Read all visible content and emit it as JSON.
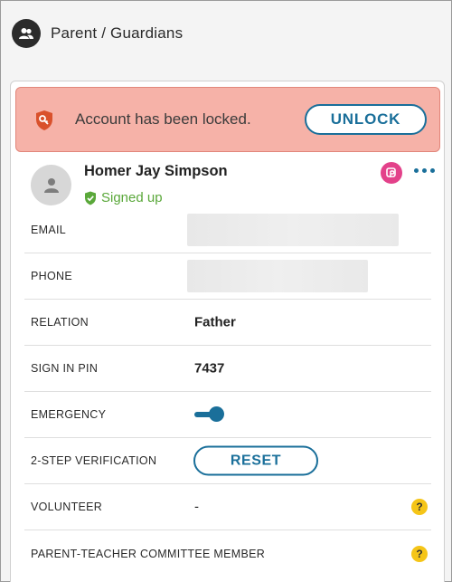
{
  "header": {
    "title": "Parent / Guardians",
    "icon": "people-icon"
  },
  "banner": {
    "message": "Account has been locked.",
    "unlock_label": "UNLOCK",
    "icon": "locked-shield-icon",
    "bg_color": "#f6b2a8"
  },
  "contact": {
    "name": "Homer Jay Simpson",
    "status": "Signed up",
    "status_color": "#5aa83a",
    "avatar_icon": "person-icon",
    "app_icon": "parent-app-icon",
    "menu_icon": "more-horizontal-icon"
  },
  "fields": {
    "email": {
      "label": "EMAIL"
    },
    "phone": {
      "label": "PHONE"
    },
    "relation": {
      "label": "RELATION",
      "value": "Father"
    },
    "pin": {
      "label": "SIGN IN PIN",
      "value": "7437"
    },
    "emergency": {
      "label": "EMERGENCY",
      "enabled": true
    },
    "two_step": {
      "label": "2-STEP VERIFICATION",
      "button_label": "RESET"
    },
    "volunteer": {
      "label": "VOLUNTEER",
      "value": "-",
      "help": "?"
    },
    "ptc": {
      "label": "PARENT-TEACHER COMMITTEE MEMBER",
      "help": "?"
    }
  },
  "accent_color": "#1a6f9a"
}
